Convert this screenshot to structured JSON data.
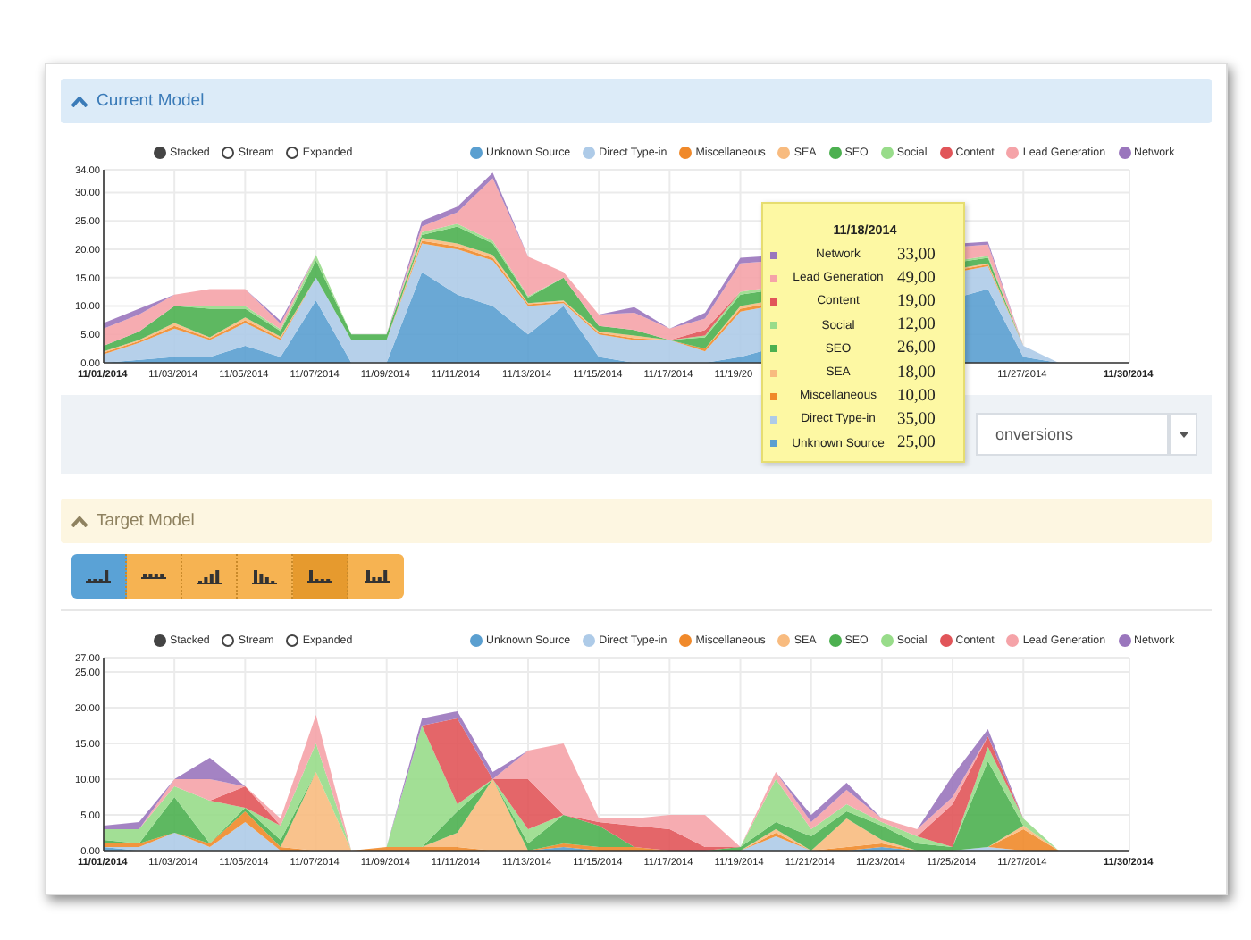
{
  "current_model": {
    "title": "Current Model",
    "view_modes": [
      {
        "label": "Stacked",
        "selected": true
      },
      {
        "label": "Stream",
        "selected": false
      },
      {
        "label": "Expanded",
        "selected": false
      }
    ],
    "chart_data": {
      "type": "area",
      "stacked": true,
      "grid": true,
      "categories": [
        "11/01/2014",
        null,
        "11/03/2014",
        null,
        "11/05/2014",
        null,
        "11/07/2014",
        null,
        "11/09/2014",
        null,
        "11/11/2014",
        null,
        "11/13/2014",
        null,
        "11/15/2014",
        null,
        "11/17/2014",
        null,
        "11/19/20",
        null,
        null,
        null,
        null,
        null,
        null,
        null,
        "11/27/2014",
        null,
        null,
        "11/30/2014"
      ],
      "ylim": [
        0,
        34
      ],
      "yticks": [
        {
          "value": 0,
          "label": "0.00"
        },
        {
          "value": 5,
          "label": "5.00"
        },
        {
          "value": 10,
          "label": "10.00"
        },
        {
          "value": 15,
          "label": "15.00"
        },
        {
          "value": 20,
          "label": "20.00"
        },
        {
          "value": 25,
          "label": "25.00"
        },
        {
          "value": 30,
          "label": "30.00"
        },
        {
          "value": 34,
          "label": "34.00"
        }
      ],
      "series": [
        {
          "name": "Unknown Source",
          "color": "#5a9fd0",
          "values": [
            0,
            0.5,
            1,
            1,
            3,
            1,
            11,
            0,
            0,
            16,
            12,
            10,
            5,
            10,
            1,
            0,
            0,
            0,
            1,
            null,
            null,
            null,
            null,
            null,
            null,
            13,
            1,
            0,
            null,
            null
          ]
        },
        {
          "name": "Direct Type-in",
          "color": "#aecbe8",
          "values": [
            1.5,
            3,
            5,
            3,
            4,
            3,
            4,
            4,
            4,
            5,
            8,
            8,
            5,
            0.5,
            4,
            4,
            4,
            2,
            8,
            null,
            null,
            null,
            null,
            null,
            null,
            4,
            2,
            0,
            null,
            null
          ]
        },
        {
          "name": "Miscellaneous",
          "color": "#f0892a",
          "values": [
            0.3,
            0.3,
            0.5,
            0.3,
            0.5,
            0.3,
            0,
            0,
            0,
            0.5,
            0.5,
            0.5,
            0.3,
            0.3,
            0.3,
            0.3,
            0,
            0.5,
            0.5,
            null,
            null,
            null,
            null,
            null,
            null,
            0.3,
            0,
            0,
            null,
            null
          ]
        },
        {
          "name": "SEA",
          "color": "#f8bb7f",
          "values": [
            0.2,
            0.2,
            0.5,
            0.2,
            0.5,
            0.3,
            0,
            0,
            0,
            0.5,
            0.5,
            0.5,
            0.2,
            0.2,
            0.2,
            0.5,
            0,
            0,
            0.5,
            null,
            null,
            null,
            null,
            null,
            null,
            0.2,
            0,
            0,
            null,
            null
          ]
        },
        {
          "name": "SEO",
          "color": "#4cb050",
          "values": [
            1,
            1.5,
            3,
            5,
            1.5,
            1,
            3,
            1,
            1,
            0.5,
            3,
            2,
            1,
            4,
            1,
            1,
            0,
            2,
            2,
            null,
            null,
            null,
            null,
            null,
            null,
            1,
            0,
            0,
            null,
            null
          ]
        },
        {
          "name": "Social",
          "color": "#98dc8a",
          "values": [
            0,
            0,
            0,
            0.5,
            0.5,
            0.3,
            1,
            0,
            0,
            0.5,
            0.5,
            0.5,
            0.2,
            0,
            0,
            0,
            0,
            0.3,
            0.5,
            null,
            null,
            null,
            null,
            null,
            null,
            0.3,
            0,
            0,
            null,
            null
          ]
        },
        {
          "name": "Content",
          "color": "#e15559",
          "values": [
            null,
            null,
            null,
            null,
            null,
            null,
            null,
            null,
            null,
            null,
            null,
            null,
            null,
            null,
            null,
            null,
            0,
            1,
            0,
            null,
            null,
            null,
            null,
            null,
            null,
            null,
            null,
            null,
            null,
            null
          ]
        },
        {
          "name": "Lead Generation",
          "color": "#f5a3a8",
          "values": [
            3,
            3,
            2,
            3,
            3,
            1,
            0,
            0,
            0,
            1,
            2,
            11,
            7,
            1,
            2,
            3,
            2,
            2,
            5,
            null,
            null,
            null,
            null,
            null,
            null,
            2,
            0,
            0,
            null,
            null
          ]
        },
        {
          "name": "Network",
          "color": "#9a76bd",
          "values": [
            1,
            1,
            0,
            0,
            0,
            0.5,
            0,
            0,
            0,
            1,
            1,
            1,
            0,
            0,
            0,
            1,
            0,
            1,
            1,
            null,
            null,
            null,
            null,
            null,
            null,
            0.5,
            0,
            0,
            null,
            null
          ]
        }
      ]
    },
    "tooltip": {
      "title": "11/18/2014",
      "rows": [
        {
          "label": "Network",
          "value": "33,00",
          "color": "#9a76bd"
        },
        {
          "label": "Lead Generation",
          "value": "49,00",
          "color": "#f5a3a8"
        },
        {
          "label": "Content",
          "value": "19,00",
          "color": "#e15559"
        },
        {
          "label": "Social",
          "value": "12,00",
          "color": "#98dc8a"
        },
        {
          "label": "SEO",
          "value": "26,00",
          "color": "#4cb050"
        },
        {
          "label": "SEA",
          "value": "18,00",
          "color": "#f8bb7f"
        },
        {
          "label": "Miscellaneous",
          "value": "10,00",
          "color": "#f0892a"
        },
        {
          "label": "Direct Type-in",
          "value": "35,00",
          "color": "#aecbe8"
        },
        {
          "label": "Unknown Source",
          "value": "25,00",
          "color": "#5a9fd0"
        }
      ]
    },
    "metric_select": {
      "value": "onversions"
    }
  },
  "target_model": {
    "title": "Target Model",
    "chart_types": [
      {
        "kind": "rising-end",
        "selected": true,
        "pressed": false
      },
      {
        "kind": "flat",
        "selected": false,
        "pressed": false
      },
      {
        "kind": "rising",
        "selected": false,
        "pressed": false
      },
      {
        "kind": "falling",
        "selected": false,
        "pressed": false
      },
      {
        "kind": "falling-end",
        "selected": false,
        "pressed": true
      },
      {
        "kind": "u-shape",
        "selected": false,
        "pressed": false
      }
    ],
    "view_modes": [
      {
        "label": "Stacked",
        "selected": true
      },
      {
        "label": "Stream",
        "selected": false
      },
      {
        "label": "Expanded",
        "selected": false
      }
    ],
    "chart_data": {
      "type": "area",
      "stacked": true,
      "grid": true,
      "categories": [
        "11/01/2014",
        null,
        "11/03/2014",
        null,
        "11/05/2014",
        null,
        "11/07/2014",
        null,
        "11/09/2014",
        null,
        "11/11/2014",
        null,
        "11/13/2014",
        null,
        "11/15/2014",
        null,
        "11/17/2014",
        null,
        "11/19/2014",
        null,
        "11/21/2014",
        null,
        "11/23/2014",
        null,
        "11/25/2014",
        null,
        "11/27/2014",
        null,
        null,
        "11/30/2014"
      ],
      "ylim": [
        0,
        27
      ],
      "yticks": [
        {
          "value": 0,
          "label": "0.00"
        },
        {
          "value": 5,
          "label": "5.00"
        },
        {
          "value": 10,
          "label": "10.00"
        },
        {
          "value": 15,
          "label": "15.00"
        },
        {
          "value": 20,
          "label": "20.00"
        },
        {
          "value": 25,
          "label": "25.00"
        },
        {
          "value": 27,
          "label": "27.00"
        }
      ],
      "series": [
        {
          "name": "Unknown Source",
          "color": "#5a9fd0",
          "values": [
            0.5,
            0,
            0,
            0,
            0,
            0,
            0,
            0,
            0,
            0,
            0,
            0,
            0,
            0.5,
            0,
            0,
            0,
            0,
            0,
            0,
            0,
            0,
            0.5,
            0,
            0,
            0,
            0,
            0,
            null,
            null
          ]
        },
        {
          "name": "Direct Type-in",
          "color": "#aecbe8",
          "values": [
            0,
            0.5,
            2.5,
            0.5,
            4,
            0,
            0,
            0,
            0,
            0,
            0,
            0,
            0,
            0,
            0,
            0,
            0,
            0,
            0,
            2,
            0,
            0,
            0,
            0,
            0,
            0.5,
            0,
            0,
            null,
            null
          ]
        },
        {
          "name": "Miscellaneous",
          "color": "#f0892a",
          "values": [
            0.5,
            0.5,
            0,
            0.5,
            1.5,
            0.5,
            0,
            0,
            0.5,
            0.5,
            0.5,
            0,
            0,
            0.5,
            0.5,
            0.5,
            0,
            0,
            0,
            0.5,
            0,
            0.5,
            0.5,
            0,
            0,
            0,
            3,
            0,
            null,
            null
          ]
        },
        {
          "name": "SEA",
          "color": "#f8bb7f",
          "values": [
            0,
            0,
            0,
            0,
            0,
            0,
            11,
            0,
            0,
            0,
            2,
            10,
            0,
            0,
            0,
            0,
            0,
            0,
            0,
            0.5,
            0,
            4,
            0.5,
            0,
            0,
            0,
            0.5,
            0,
            null,
            null
          ]
        },
        {
          "name": "SEO",
          "color": "#4cb050",
          "values": [
            0.5,
            0,
            5,
            0,
            0.5,
            1,
            0,
            0,
            0,
            0,
            3,
            0,
            1,
            4,
            3,
            0,
            0,
            0,
            0.5,
            1,
            2,
            1,
            2,
            1,
            0.5,
            12,
            0,
            0,
            null,
            null
          ]
        },
        {
          "name": "Social",
          "color": "#98dc8a",
          "values": [
            1.5,
            2,
            1.5,
            6,
            0,
            2,
            4,
            0,
            0,
            17,
            1,
            0,
            2,
            0,
            0,
            0,
            0,
            0,
            0,
            6,
            1,
            1,
            0.5,
            1,
            0,
            2,
            1,
            0,
            null,
            null
          ]
        },
        {
          "name": "Content",
          "color": "#e15559",
          "values": [
            0,
            0,
            0,
            0,
            3,
            0,
            0,
            0,
            0,
            0,
            12,
            0,
            7,
            0,
            0.5,
            3,
            3,
            0.5,
            0,
            0,
            0,
            0,
            0,
            0,
            6,
            1.5,
            0,
            0,
            null,
            null
          ]
        },
        {
          "name": "Lead Generation",
          "color": "#f5a3a8",
          "values": [
            0,
            0,
            1,
            3,
            0,
            1,
            4,
            0,
            0,
            0,
            0,
            0,
            4,
            10,
            0.5,
            1,
            2,
            4.5,
            0,
            1,
            1,
            2,
            0.5,
            1,
            1,
            0,
            0,
            0,
            null,
            null
          ]
        },
        {
          "name": "Network",
          "color": "#9a76bd",
          "values": [
            0.5,
            1,
            0,
            3,
            0,
            0,
            0,
            0,
            0,
            1,
            1,
            1,
            0,
            0,
            0,
            0,
            0,
            0,
            0,
            0,
            1,
            1,
            0,
            0,
            3,
            1,
            0,
            0,
            null,
            null
          ]
        }
      ]
    }
  }
}
